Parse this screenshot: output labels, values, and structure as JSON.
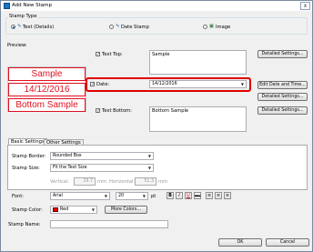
{
  "window": {
    "title": "Add New Stamp",
    "close": "x"
  },
  "stamp_type": {
    "label": "Stamp Type",
    "options": [
      {
        "label": "Text (Details)",
        "selected": true
      },
      {
        "label": "Date Stamp",
        "selected": false
      },
      {
        "label": "Image",
        "selected": false
      }
    ]
  },
  "preview": {
    "label": "Preview:",
    "lines": [
      "Sample",
      "14/12/2016",
      "Bottom Sample"
    ]
  },
  "text_top": {
    "label": "Text Top:",
    "checked": true,
    "value": "Sample",
    "button": "Detailed Settings..."
  },
  "date": {
    "label": "Date:",
    "checked": true,
    "value": "14/12/2016",
    "edit_button": "Edit Date and Time...",
    "detail_button": "Detailed Settings..."
  },
  "text_bottom": {
    "label": "Text Bottom:",
    "checked": true,
    "value": "Bottom Sample",
    "button": "Detailed Settings..."
  },
  "tabs": [
    {
      "label": "Basic Settings",
      "active": true
    },
    {
      "label": "Other Settings",
      "active": false
    }
  ],
  "basic": {
    "border_label": "Stamp Border:",
    "border_value": "Rounded Box",
    "size_label": "Stamp Size:",
    "size_value": "Fit the Text Size",
    "vertical_label": "Vertical:",
    "vertical_value": "29.7",
    "vertical_unit": "mm",
    "horizontal_label": "Horizontal:",
    "horizontal_value": "51.3",
    "horizontal_unit": "mm",
    "font_label": "Font:",
    "font_value": "Arial",
    "font_size": "20",
    "font_unit": "pt",
    "bold": "B",
    "italic": "I",
    "underline": "U",
    "strike": "abc",
    "color_label": "Stamp Color:",
    "color_value": "Red",
    "color_hex": "#e00000",
    "more_colors": "More Colors..."
  },
  "stamp_name": {
    "label": "Stamp Name:",
    "value": ""
  },
  "footer": {
    "ok": "OK",
    "cancel": "Cancel"
  }
}
